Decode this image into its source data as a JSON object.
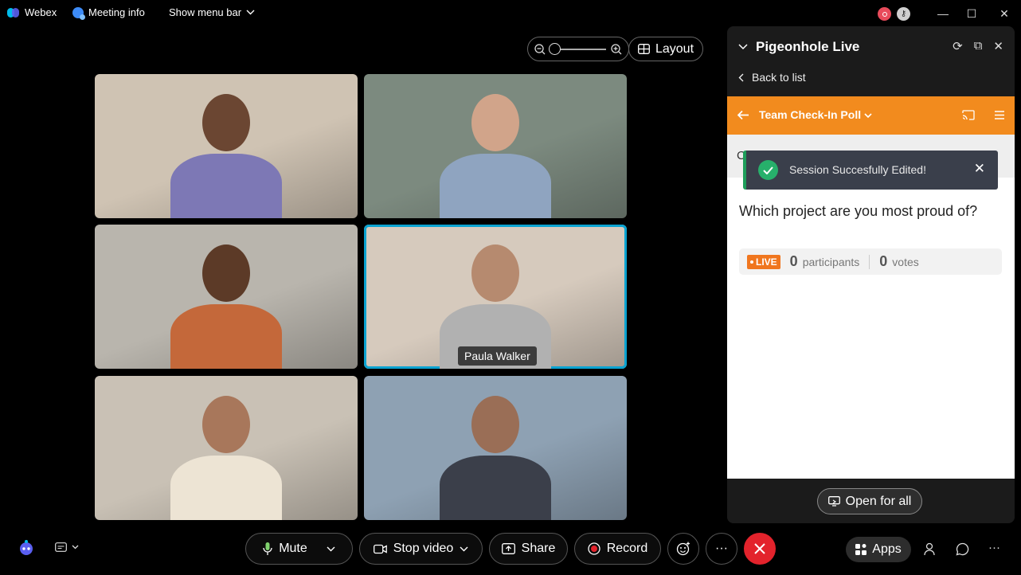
{
  "titlebar": {
    "app_name": "Webex",
    "meeting_info": "Meeting info",
    "show_menu_bar": "Show menu bar",
    "minimize": "—",
    "maximize": "☐",
    "close": "✕"
  },
  "zoom": {
    "zoom_out_icon": "⊖",
    "zoom_in_icon": "⊕",
    "level": 0.0
  },
  "layout_button": {
    "label": "Layout"
  },
  "tiles": [
    {
      "name": "",
      "bg": "#cfc3b3",
      "head": "#6b4632",
      "shirt": "#7d78b5"
    },
    {
      "name": "",
      "bg": "#7c8a7f",
      "head": "#d1a48a",
      "shirt": "#8fa4c0"
    },
    {
      "name": "",
      "bg": "#b9b5ad",
      "head": "#5c3a27",
      "shirt": "#c4683a"
    },
    {
      "name": "Paula Walker",
      "bg": "#d6cabd",
      "head": "#b68a6f",
      "shirt": "#b1b1b1"
    },
    {
      "name": "",
      "bg": "#c9c1b5",
      "head": "#a8775b",
      "shirt": "#ede4d4"
    },
    {
      "name": "",
      "bg": "#8ea1b3",
      "head": "#9a6e56",
      "shirt": "#3b3f4a"
    }
  ],
  "panel": {
    "title": "Pigeonhole Live",
    "back_to_list": "Back to list",
    "session_title": "Team Check-In Poll",
    "toast": "Session Succesfully Edited!",
    "question": "Which project are you most proud of?",
    "live": "LIVE",
    "participants_count": "0",
    "participants_label": "participants",
    "votes_count": "0",
    "votes_label": "votes",
    "open_for_all": "Open for all",
    "hidden_letter": "C"
  },
  "controls": {
    "mute": "Mute",
    "stop_video": "Stop video",
    "share": "Share",
    "record": "Record",
    "more": "···",
    "apps": "Apps"
  },
  "colors": {
    "accent_orange": "#f28b1e",
    "end_call_red": "#e3232c",
    "active_tile_border": "#0aa3d1",
    "toast_bg": "#3a3f4b",
    "success_green": "#27b06b"
  }
}
